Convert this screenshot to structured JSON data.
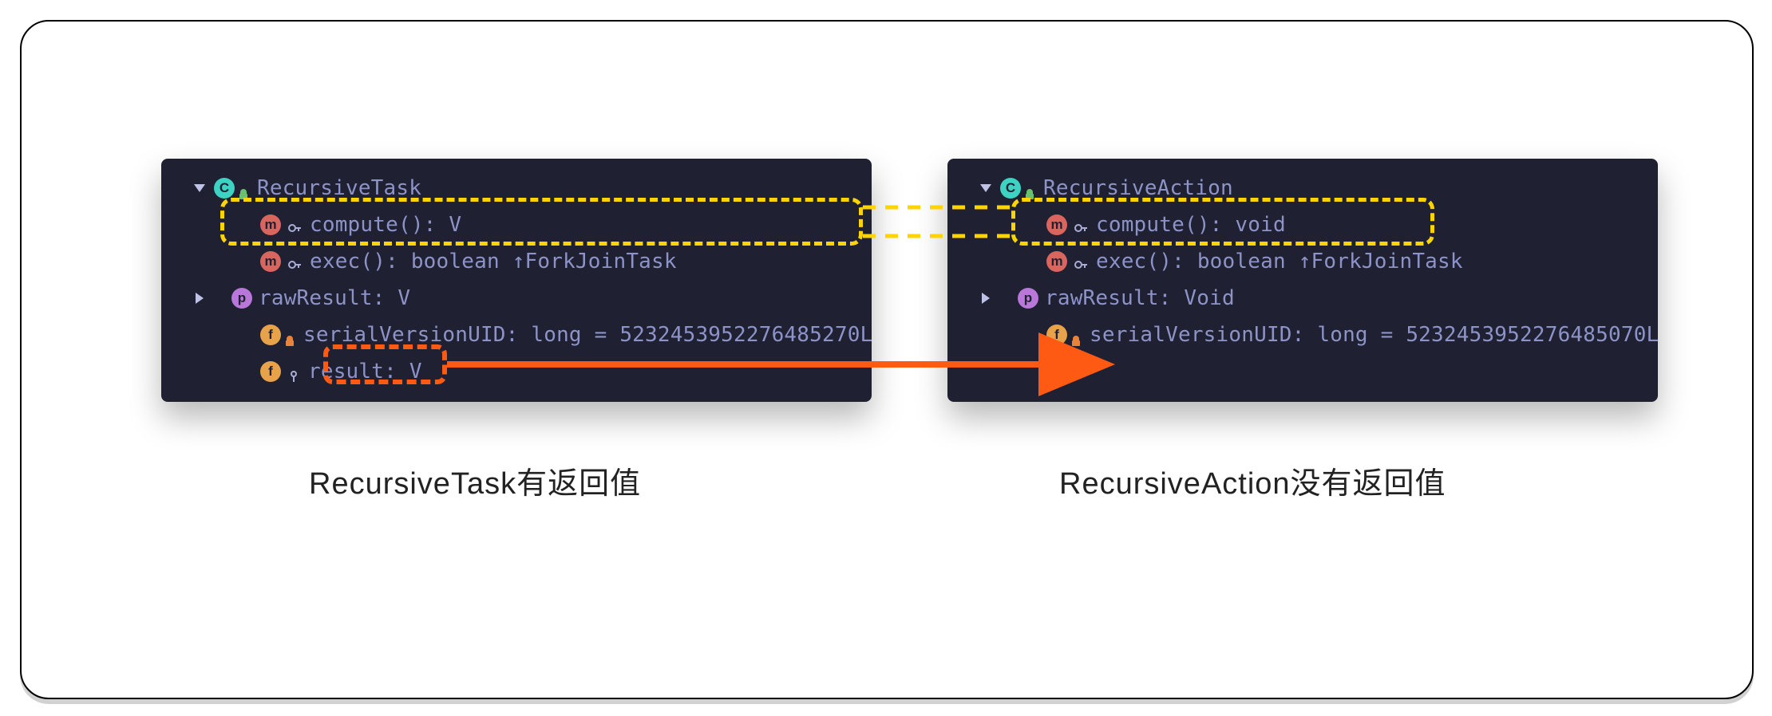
{
  "left_panel": {
    "title": "RecursiveTask",
    "rows": {
      "compute": "compute(): V",
      "exec": "exec(): boolean ↑ForkJoinTask",
      "rawResult": "rawResult: V",
      "serialUID": "serialVersionUID: long = 5232453952276485270L",
      "result": "result: V"
    }
  },
  "right_panel": {
    "title": "RecursiveAction",
    "rows": {
      "compute": "compute(): void",
      "exec": "exec(): boolean ↑ForkJoinTask",
      "rawResult": "rawResult: Void",
      "serialUID": "serialVersionUID: long = 5232453952276485070L"
    }
  },
  "captions": {
    "left": "RecursiveTask有返回值",
    "right": "RecursiveAction没有返回值"
  }
}
